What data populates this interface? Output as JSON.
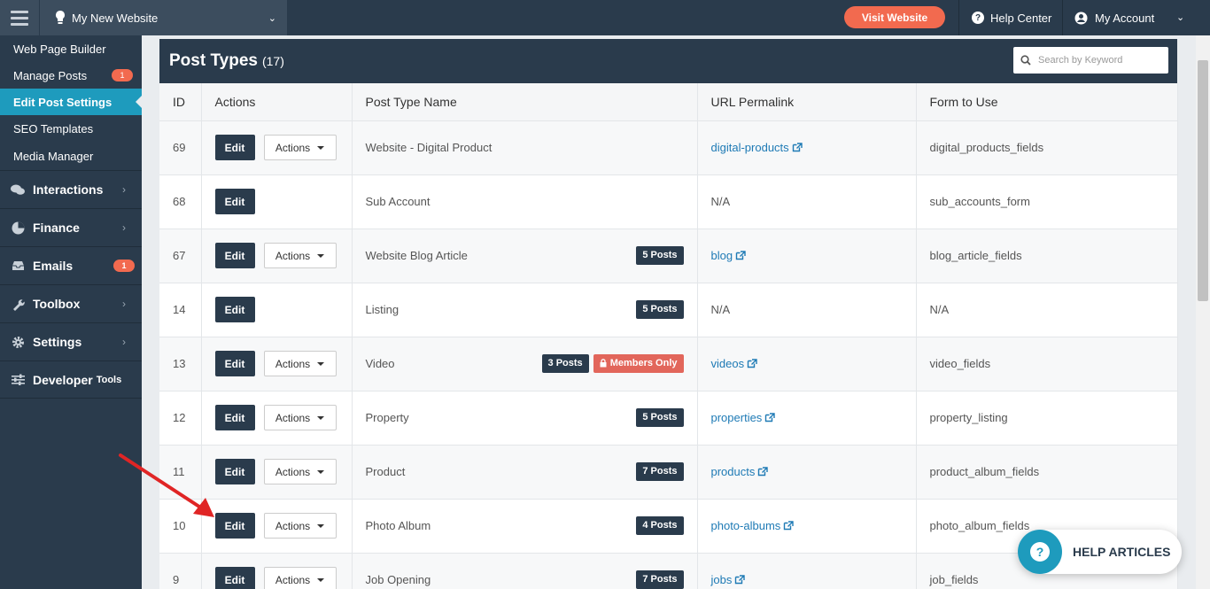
{
  "topbar": {
    "site_name": "My New Website",
    "visit_label": "Visit Website",
    "help_label": "Help Center",
    "account_label": "My Account",
    "accent": "#f26a4f"
  },
  "sidebar": {
    "sub_items": [
      {
        "label": "Web Page Builder",
        "badge": ""
      },
      {
        "label": "Manage Posts",
        "badge": "1"
      },
      {
        "label": "Edit Post Settings",
        "badge": "",
        "active": true
      },
      {
        "label": "SEO Templates",
        "badge": ""
      },
      {
        "label": "Media Manager",
        "badge": ""
      }
    ],
    "main_items": [
      {
        "label": "Interactions",
        "icon": "chat-bubbles-icon"
      },
      {
        "label": "Finance",
        "icon": "pie-chart-icon"
      },
      {
        "label": "Emails",
        "icon": "inbox-icon",
        "badge": "1"
      },
      {
        "label": "Toolbox",
        "icon": "wrench-icon"
      },
      {
        "label": "Settings",
        "icon": "gear-icon"
      },
      {
        "label": "Developer",
        "suffix": "Tools",
        "icon": "sliders-icon"
      }
    ]
  },
  "panel": {
    "title": "Post Types",
    "count": "(17)",
    "search_placeholder": "Search by Keyword"
  },
  "table": {
    "headers": [
      "ID",
      "Actions",
      "Post Type Name",
      "URL Permalink",
      "Form to Use"
    ],
    "edit_label": "Edit",
    "actions_label": "Actions",
    "rows": [
      {
        "id": "69",
        "name": "Website - Digital Product",
        "posts": "",
        "members": "",
        "permalink": "digital-products",
        "is_link": true,
        "form": "digital_products_fields",
        "has_actions": true
      },
      {
        "id": "68",
        "name": "Sub Account",
        "posts": "",
        "members": "",
        "permalink": "N/A",
        "is_link": false,
        "form": "sub_accounts_form",
        "has_actions": false
      },
      {
        "id": "67",
        "name": "Website Blog Article",
        "posts": "5 Posts",
        "members": "",
        "permalink": "blog",
        "is_link": true,
        "form": "blog_article_fields",
        "has_actions": true
      },
      {
        "id": "14",
        "name": "Listing",
        "posts": "5 Posts",
        "members": "",
        "permalink": "N/A",
        "is_link": false,
        "form": "N/A",
        "has_actions": false
      },
      {
        "id": "13",
        "name": "Video",
        "posts": "3 Posts",
        "members": "Members Only",
        "permalink": "videos",
        "is_link": true,
        "form": "video_fields",
        "has_actions": true
      },
      {
        "id": "12",
        "name": "Property",
        "posts": "5 Posts",
        "members": "",
        "permalink": "properties",
        "is_link": true,
        "form": "property_listing",
        "has_actions": true
      },
      {
        "id": "11",
        "name": "Product",
        "posts": "7 Posts",
        "members": "",
        "permalink": "products",
        "is_link": true,
        "form": "product_album_fields",
        "has_actions": true
      },
      {
        "id": "10",
        "name": "Photo Album",
        "posts": "4 Posts",
        "members": "",
        "permalink": "photo-albums",
        "is_link": true,
        "form": "photo_album_fields",
        "has_actions": true
      },
      {
        "id": "9",
        "name": "Job Opening",
        "posts": "7 Posts",
        "members": "",
        "permalink": "jobs",
        "is_link": true,
        "form": "job_fields",
        "has_actions": true
      }
    ]
  },
  "help_widget": {
    "label": "HELP ARTICLES"
  }
}
